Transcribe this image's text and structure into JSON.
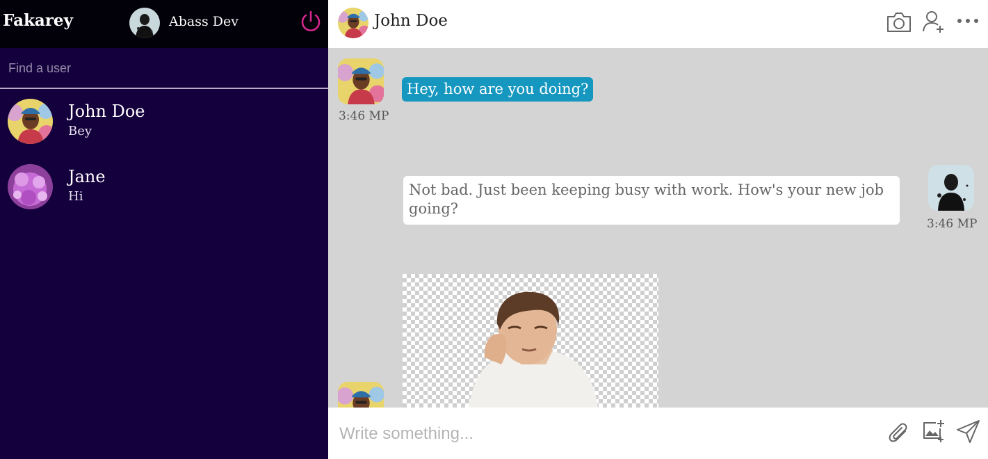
{
  "sidebar": {
    "brand": "Fakarey",
    "current_user": {
      "name": "Abass Dev"
    },
    "search": {
      "placeholder": "Find a user"
    },
    "contacts": [
      {
        "name": "John Doe",
        "last_message": "Bey"
      },
      {
        "name": "Jane",
        "last_message": "Hi"
      }
    ]
  },
  "chat": {
    "header": {
      "contact_name": "John Doe"
    },
    "messages": [
      {
        "direction": "incoming",
        "text": "Hey, how are you doing?",
        "time": "3:46 MP"
      },
      {
        "direction": "outgoing",
        "text": "Not bad. Just been keeping busy with work. How's your new job going?",
        "time": "3:46 MP"
      },
      {
        "direction": "incoming",
        "type": "image"
      }
    ],
    "composer": {
      "placeholder": "Write something..."
    }
  },
  "colors": {
    "sidebar_bg": "#14003c",
    "sidebar_header_bg": "#020008",
    "accent_power": "#d6278f",
    "incoming_bubble": "#1597bf",
    "chat_bg": "#d4d4d4"
  },
  "icons": [
    "power-icon",
    "camera-icon",
    "add-user-icon",
    "more-icon",
    "attach-icon",
    "add-image-icon",
    "send-icon"
  ]
}
